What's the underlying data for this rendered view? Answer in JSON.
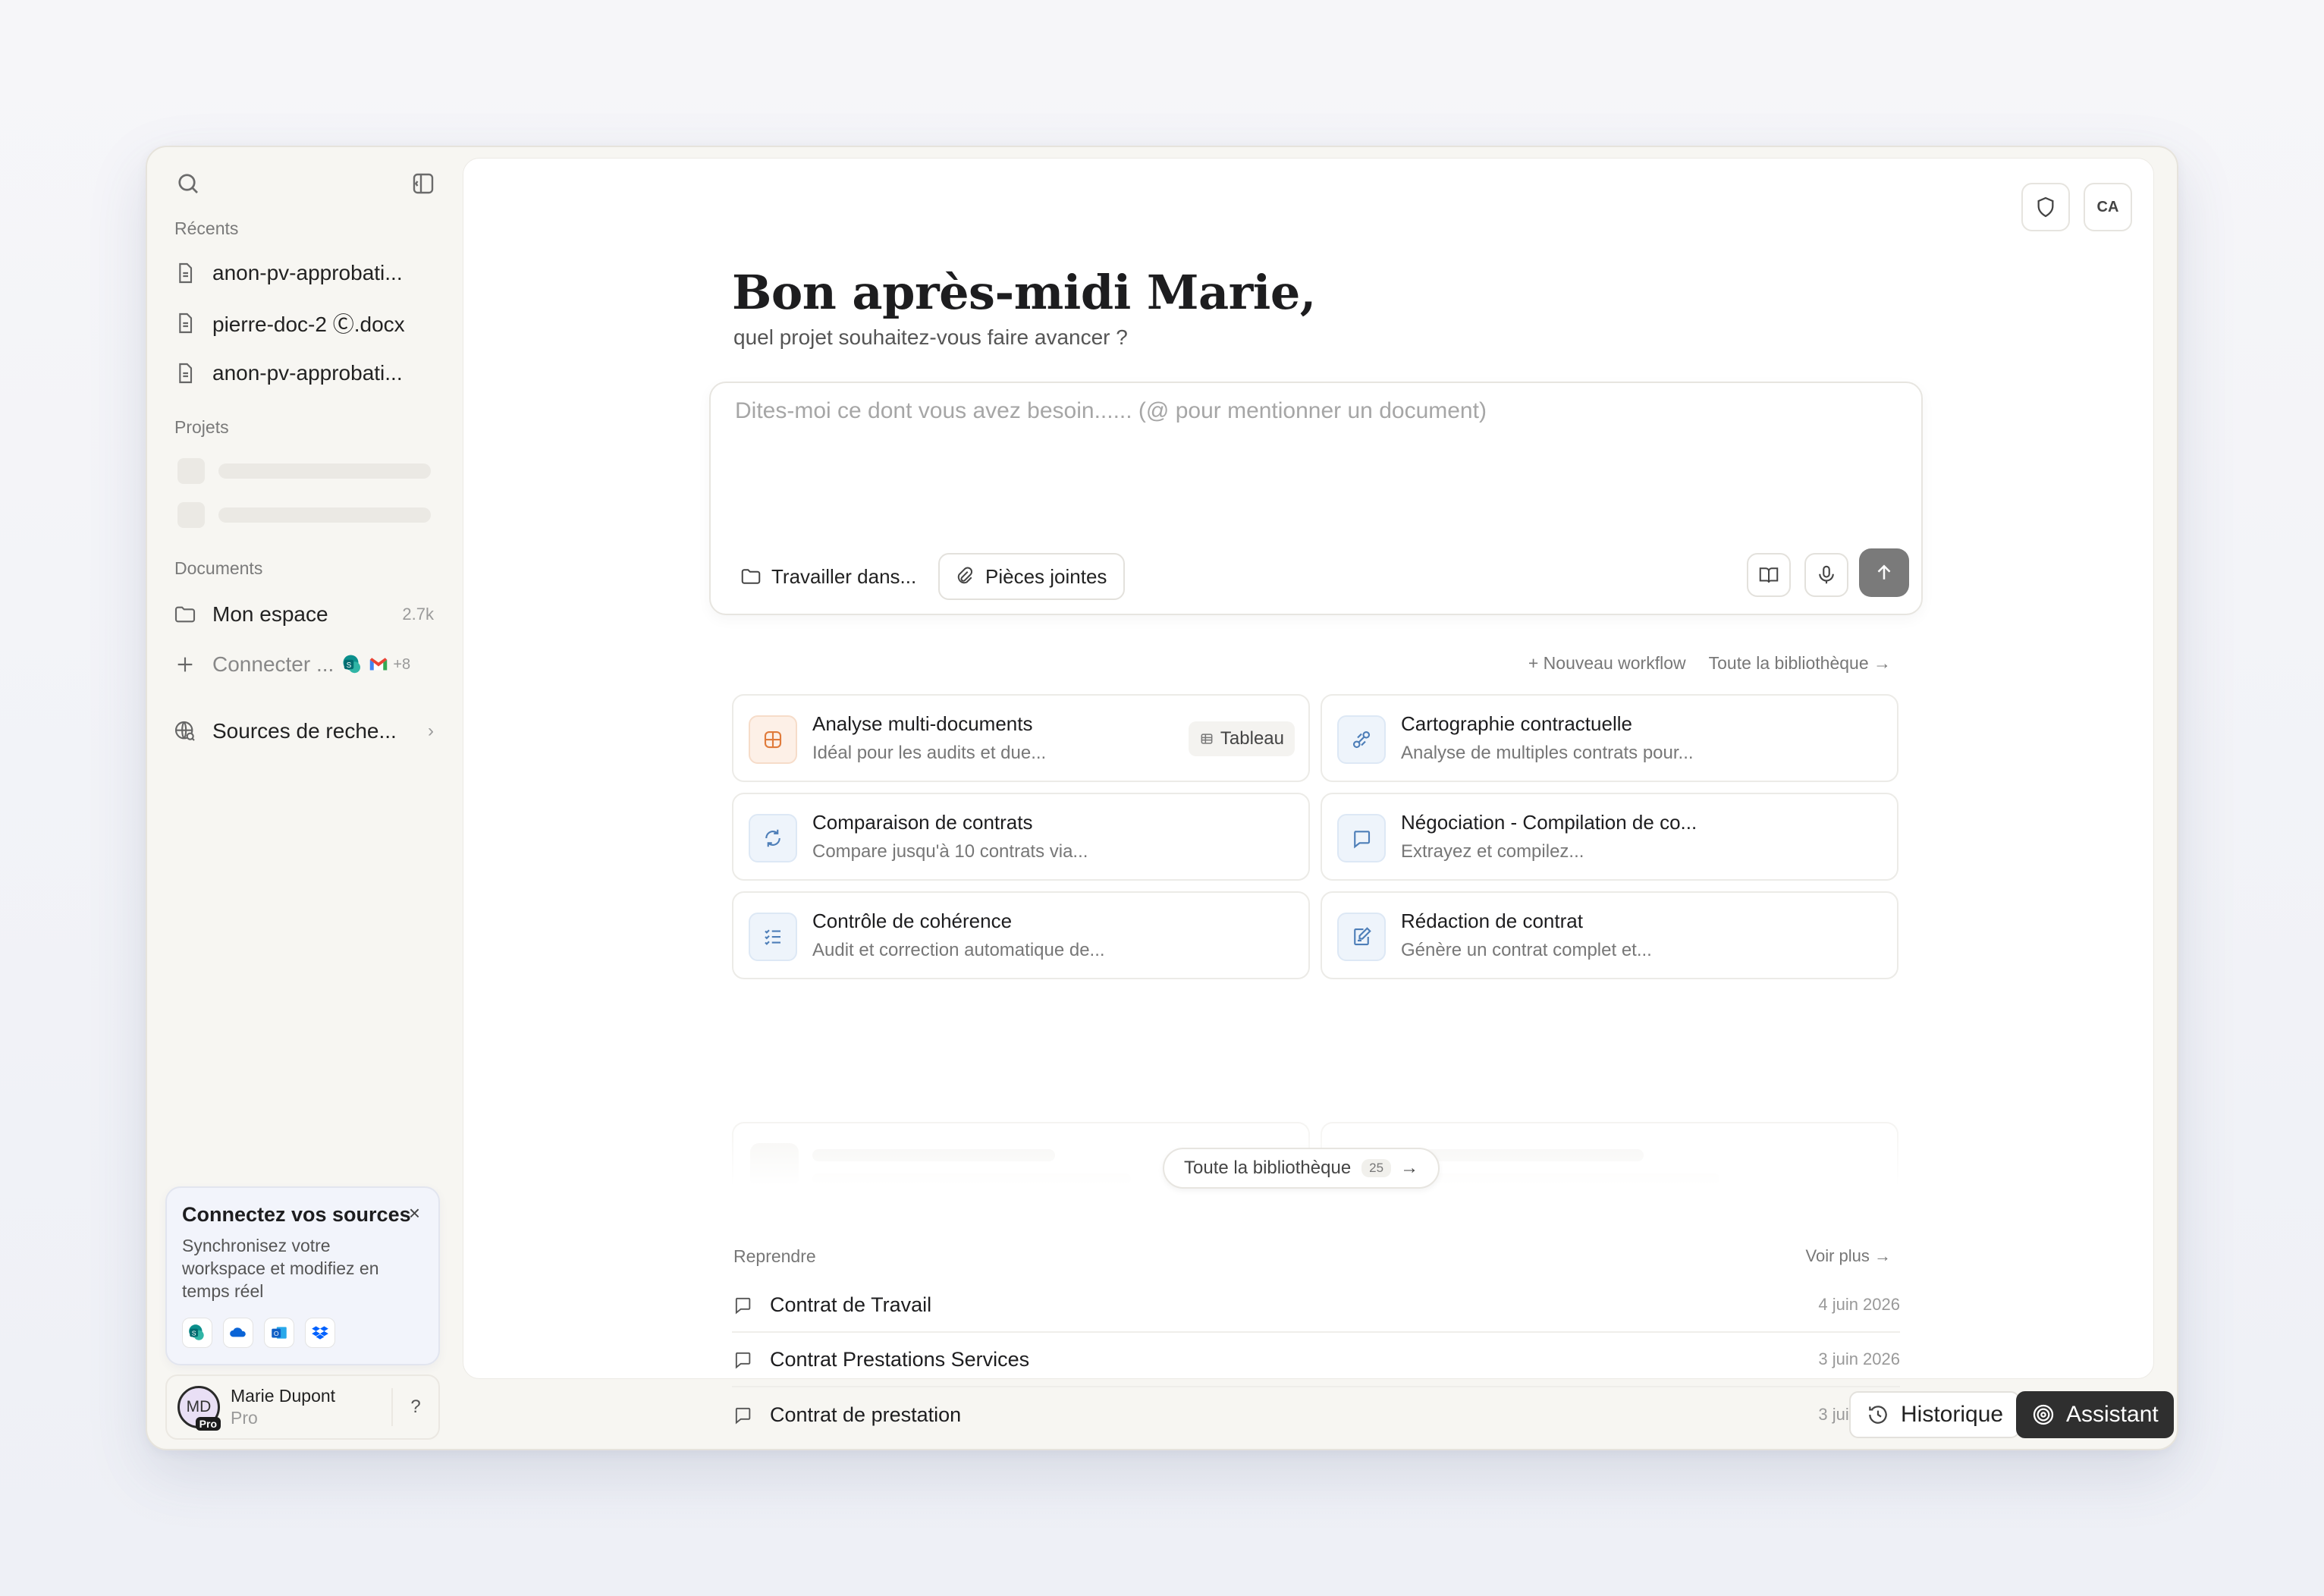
{
  "sidebar": {
    "recents_title": "Récents",
    "recents": [
      {
        "label": "anon-pv-approbati..."
      },
      {
        "label": "pierre-doc-2 Ⓒ.docx"
      },
      {
        "label": "anon-pv-approbati..."
      }
    ],
    "projects_title": "Projets",
    "documents_title": "Documents",
    "my_space": {
      "label": "Mon espace",
      "count": "2.7k"
    },
    "connect": {
      "label": "Connecter ...",
      "more": "+8"
    },
    "sources": {
      "label": "Sources de reche..."
    },
    "connect_card": {
      "title": "Connectez vos sources",
      "close": "×",
      "desc": "Synchronisez votre workspace et modifiez en temps réel",
      "services": [
        "sharepoint-icon",
        "onedrive-icon",
        "outlook-icon",
        "dropbox-icon"
      ]
    },
    "user": {
      "initials": "MD",
      "badge": "Pro",
      "name": "Marie Dupont",
      "plan": "Pro",
      "help": "?"
    }
  },
  "header": {
    "avatar_label": "CA"
  },
  "main": {
    "greeting": "Bon après-midi Marie,",
    "subtitle": "quel projet souhaitez-vous faire avancer ?",
    "composer": {
      "placeholder": "Dites-moi ce dont vous avez besoin...... (@ pour mentionner un document)",
      "work_in": "Travailler dans...",
      "attachments": "Pièces jointes"
    },
    "workflow_links": {
      "new": "+ Nouveau workflow",
      "library": "Toute la bibliothèque →"
    },
    "workflows": [
      {
        "title": "Analyse multi-documents",
        "desc": "Idéal pour les audits et due...",
        "tag": "Tableau"
      },
      {
        "title": "Cartographie contractuelle",
        "desc": "Analyse de multiples contrats pour..."
      },
      {
        "title": "Comparaison de contrats",
        "desc": "Compare jusqu'à 10 contrats via..."
      },
      {
        "title": "Négociation - Compilation de co...",
        "desc": "Extrayez et compilez..."
      },
      {
        "title": "Contrôle de cohérence",
        "desc": "Audit et correction automatique de..."
      },
      {
        "title": "Rédaction de contrat",
        "desc": "Génère un contrat complet et..."
      }
    ],
    "library_pill": {
      "label": "Toute la bibliothèque",
      "count": "25",
      "arrow": "→"
    },
    "resume": {
      "title": "Reprendre",
      "more": "Voir plus →",
      "items": [
        {
          "title": "Contrat de Travail",
          "date": "4 juin 2026"
        },
        {
          "title": "Contrat Prestations Services",
          "date": "3 juin 2026"
        },
        {
          "title": "Contrat de prestation",
          "date": "3 juin 2026"
        }
      ]
    }
  },
  "footer": {
    "history": "Historique",
    "assistant": "Assistant"
  },
  "colors": {
    "accent_dark": "#2f2f2f",
    "orange": "#e07b3b",
    "blue": "#4d7eb8"
  }
}
